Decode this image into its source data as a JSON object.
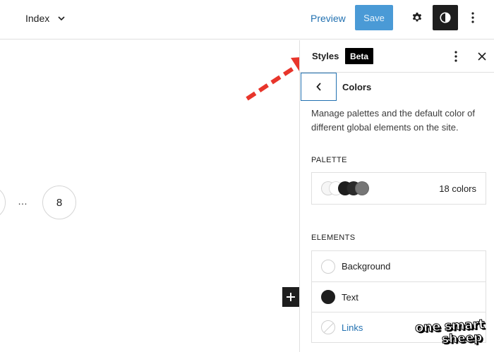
{
  "topbar": {
    "template_label": "Index",
    "preview_label": "Preview",
    "save_label": "Save"
  },
  "canvas": {
    "pagination": {
      "ellipsis": "…",
      "last_page": "8"
    }
  },
  "sidebar": {
    "title": "Styles",
    "badge": "Beta",
    "panel_title": "Colors",
    "description": "Manage palettes and the default color of different global elements on the site.",
    "palette": {
      "label": "PALETTE",
      "count": "18 colors",
      "swatch_colors": [
        "#f6f6f6",
        "#ffffff",
        "#1e1e1e",
        "#2b2b2b",
        "#767676"
      ]
    },
    "elements": {
      "label": "ELEMENTS",
      "items": [
        {
          "label": "Background",
          "color": "#ffffff"
        },
        {
          "label": "Text",
          "color": "#1e1e1e"
        },
        {
          "label": "Links",
          "color": "none"
        }
      ]
    }
  },
  "colors": {
    "accent": "#2271b1",
    "annotation_arrow": "#e8352b"
  },
  "watermark": {
    "line1": "one smart",
    "line2": "sheep"
  }
}
